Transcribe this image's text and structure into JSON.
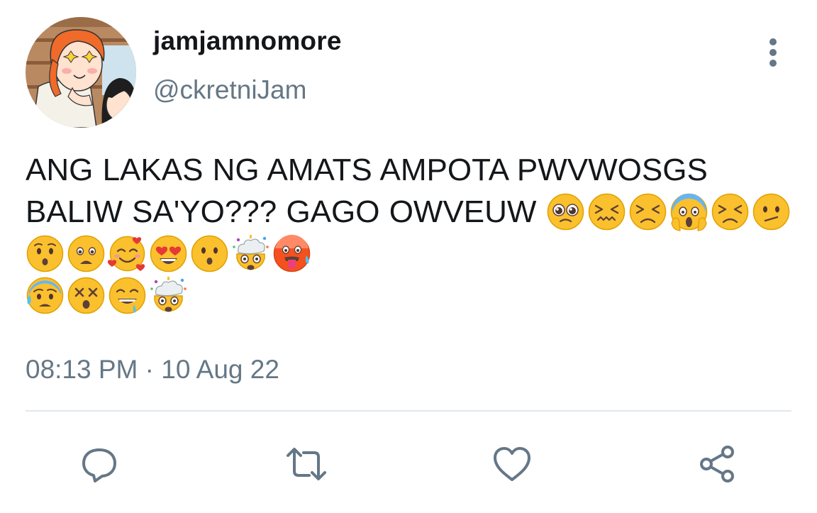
{
  "user": {
    "display_name": "jamjamnomore",
    "handle": "@ckretniJam",
    "avatar_icon": "anime-avatar-icon"
  },
  "tweet": {
    "text": "ANG LAKAS NG AMATS AMPOTA PWVWOSGS BALIW SA'YO??? GAGO OWVEUW",
    "emojis": [
      "pleading-face-icon",
      "confounded-face-icon",
      "persevering-face-icon",
      "face-screaming-in-fear-icon",
      "persevering-face-icon",
      "confused-face-icon",
      "hushed-face-icon",
      "frowning-open-mouth-face-icon",
      "smiling-face-with-hearts-icon",
      "heart-eyes-face-icon",
      "hushed-face-icon",
      "exploding-head-icon",
      "hot-face-icon",
      "anxious-face-with-sweat-icon",
      "dizzy-face-icon",
      "drooling-face-icon",
      "exploding-head-icon"
    ],
    "timestamp": "08:13 PM · 10 Aug 22"
  },
  "actions": {
    "reply_icon": "reply-icon",
    "retweet_icon": "retweet-icon",
    "like_icon": "heart-icon",
    "share_icon": "share-icon"
  },
  "colors": {
    "primary_text": "#14171a",
    "secondary_text": "#657786",
    "divider": "#e1e8ed",
    "emoji_face": "#fbc02d",
    "heart_eyes": "#e53935"
  }
}
